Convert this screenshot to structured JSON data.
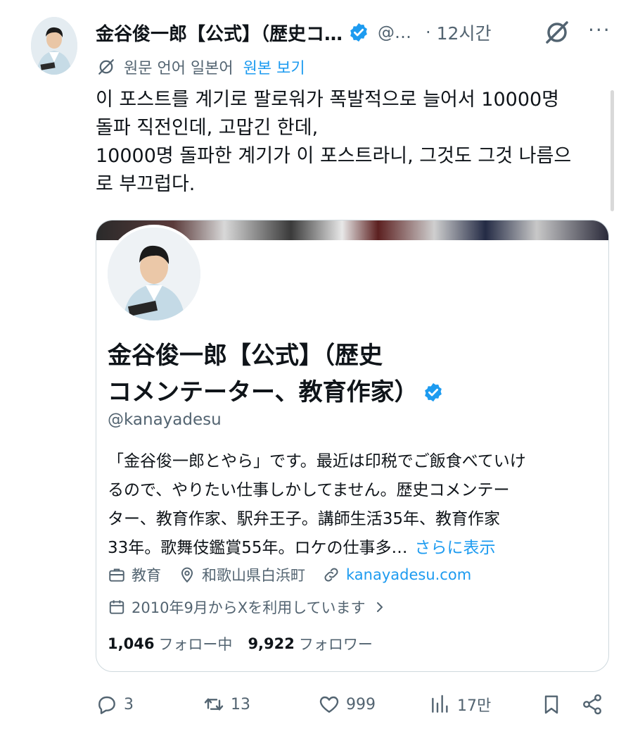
{
  "post": {
    "author_name": "金谷俊一郎【公式】（歴史コ…",
    "handle": "@…",
    "separator": "·",
    "time": "12시간",
    "more": "···",
    "translation": {
      "label": "원문 언어 일본어",
      "link": "원본 보기"
    },
    "text_lines": [
      "이 포스트를 계기로 팔로워가 폭발적으로 늘어서 10000명",
      "돌파 직전인데, 고맙긴 한데,",
      "10000명 돌파한 계기가 이 포스트라니, 그것도 그것 나름으",
      "로 부끄럽다."
    ]
  },
  "profile_card": {
    "name_line1": "金谷俊一郎【公式】（歴史",
    "name_line2": "コメンテーター、教育作家）",
    "handle": "@kanayadesu",
    "bio_lines": [
      "「金谷俊一郎とやら」です。最近は印税でご飯食べていけ",
      "るので、やりたい仕事しかしてません。歴史コメンテー",
      "ター、教育作家、駅弁王子。講師生活35年、教育作家",
      "33年。歌舞伎鑑賞55年。ロケの仕事多…"
    ],
    "show_more": "さらに表示",
    "category": "教育",
    "location": "和歌山県白浜町",
    "website": "kanayadesu.com",
    "joined": "2010年9月からXを利用しています",
    "following_count": "1,046",
    "following_label": "フォロー中",
    "followers_count": "9,922",
    "followers_label": "フォロワー"
  },
  "actions": {
    "replies": "3",
    "reposts": "13",
    "likes": "999",
    "views": "17만"
  },
  "colors": {
    "accent": "#1d9bf0",
    "secondary_text": "#536471",
    "border": "#cfd9de"
  }
}
